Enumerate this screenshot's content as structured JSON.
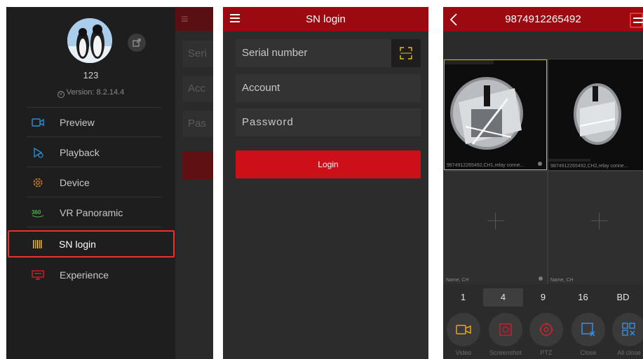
{
  "panel1": {
    "username": "123",
    "version": "Version: 8.2.14.4",
    "background_fields": [
      "Seri",
      "Acc",
      "Pas"
    ],
    "nav": [
      {
        "label": "Preview",
        "icon": "camera-icon",
        "color": "#2a8fd6"
      },
      {
        "label": "Playback",
        "icon": "playback-icon",
        "color": "#2a8fd6"
      },
      {
        "label": "Device",
        "icon": "gear-icon",
        "color": "#e07a10"
      },
      {
        "label": "VR Panoramic",
        "icon": "vr-360-icon",
        "color": "#4caf50"
      },
      {
        "label": "SN login",
        "icon": "barcode-icon",
        "color": "#e8c21a"
      },
      {
        "label": "Experience",
        "icon": "monitor-icon",
        "color": "#d61f26"
      }
    ]
  },
  "panel2": {
    "title": "SN login",
    "serial_placeholder": "Serial number",
    "account_placeholder": "Account",
    "password_placeholder": "Password",
    "login_label": "Login"
  },
  "panel3": {
    "title": "9874912265492",
    "captions": {
      "ch1": "9874912265492,CH1,relay conne...",
      "ch2": "9874912265492,CH2,relay conne...",
      "empty1": "Name, CH",
      "empty2": "Name, CH"
    },
    "splits": [
      "1",
      "4",
      "9",
      "16",
      "BD"
    ],
    "active_split": "4",
    "tools": [
      "Video",
      "Screenshot",
      "PTZ",
      "Close",
      "All close"
    ]
  },
  "colors": {
    "brand_red": "#9a0a10",
    "button_red": "#cd0f19",
    "highlight_red": "#e8322e",
    "selected_cell": "#c9b51a"
  }
}
